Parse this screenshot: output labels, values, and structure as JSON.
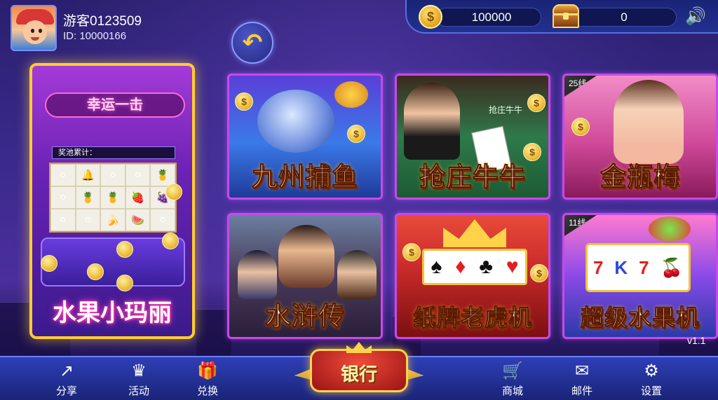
{
  "user": {
    "nickname": "游客0123509",
    "id_text": "ID: 10000166"
  },
  "currency": {
    "coins": "100000",
    "bank": "0"
  },
  "featured_game": {
    "sign": "幸运一击",
    "jackpot_label": "奖池累计：",
    "title": "水果小玛丽"
  },
  "games": [
    {
      "title": "九州捕鱼",
      "badge": ""
    },
    {
      "title": "抢庄牛牛",
      "badge": "",
      "table_text": "抢庄牛牛"
    },
    {
      "title": "金瓶梅",
      "badge": "25线"
    },
    {
      "title": "水浒传",
      "badge": ""
    },
    {
      "title": "纸牌老虎机",
      "badge": ""
    },
    {
      "title": "超级水果机",
      "badge": "11线"
    }
  ],
  "version": "v1.1",
  "bottom_nav": {
    "share": "分享",
    "activity": "活动",
    "exchange": "兑换",
    "bank": "银行",
    "shop": "商城",
    "mail": "邮件",
    "settings": "设置"
  },
  "colors": {
    "background": "#3a2a8c",
    "tile_border": "#c64ae8",
    "gold": "#ffcc33"
  }
}
